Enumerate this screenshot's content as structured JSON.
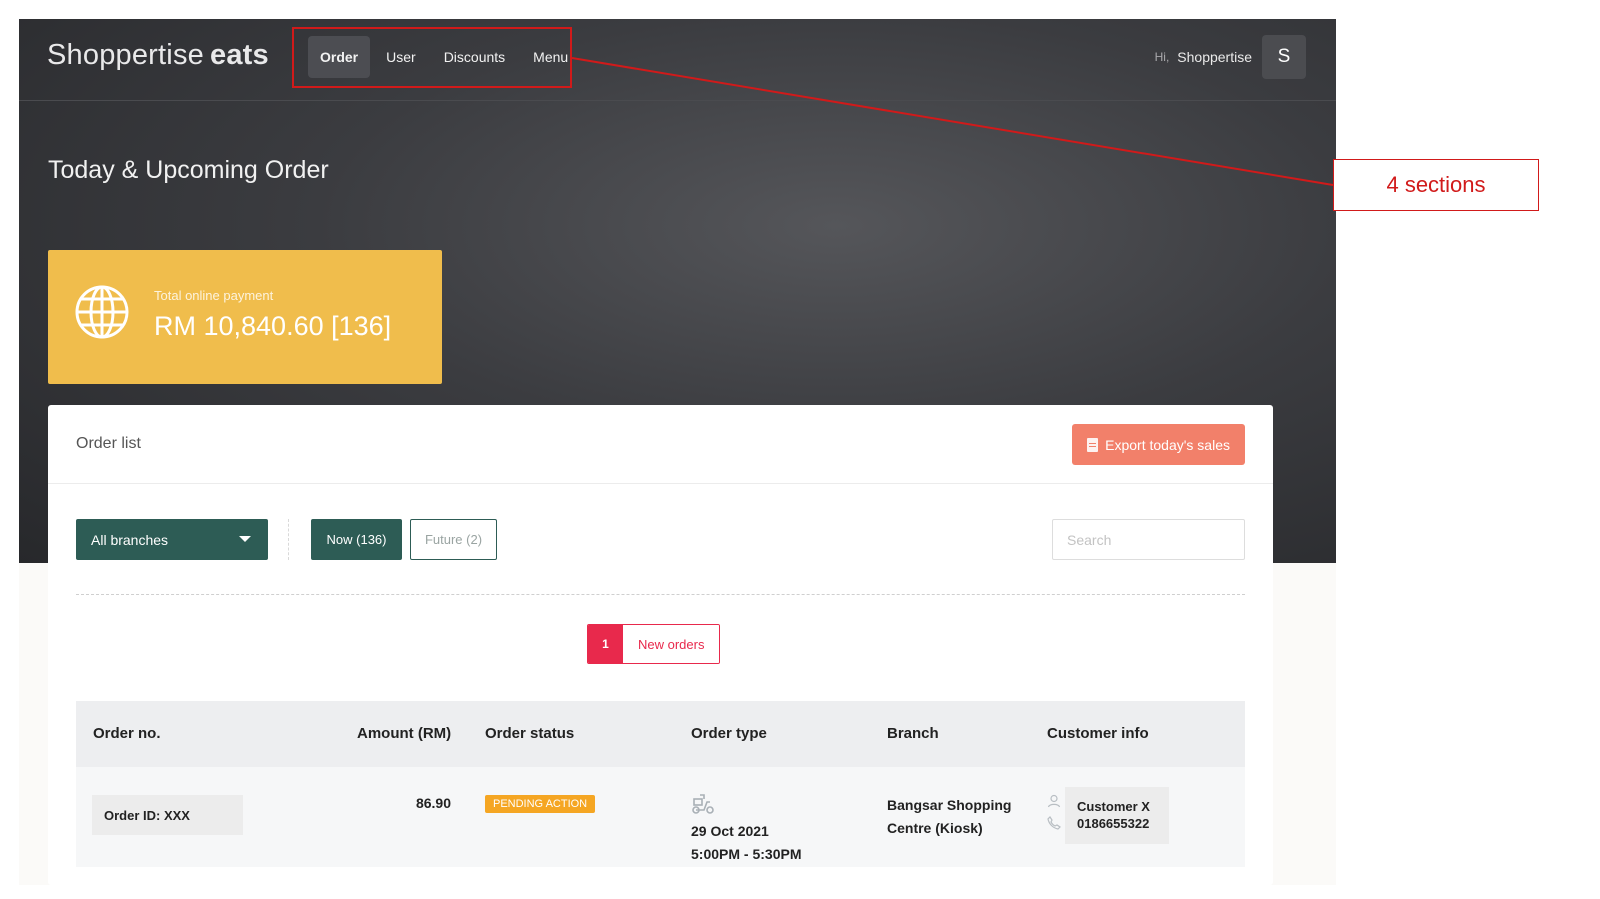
{
  "app": {
    "logo_light": "Shoppertise",
    "logo_bold": "eats"
  },
  "nav": {
    "items": [
      {
        "label": "Order",
        "active": true
      },
      {
        "label": "User",
        "active": false
      },
      {
        "label": "Discounts",
        "active": false
      },
      {
        "label": "Menu",
        "active": false
      }
    ]
  },
  "user": {
    "greeting": "Hi,",
    "name": "Shoppertise",
    "avatar_letter": "S"
  },
  "page": {
    "title": "Today & Upcoming Order"
  },
  "payment_card": {
    "label": "Total online payment",
    "value": "RM 10,840.60 [136]",
    "color": "#f0bd4c",
    "icon": "globe-icon"
  },
  "order_list": {
    "title": "Order list",
    "export_label": "Export today's sales",
    "export_icon": "document-icon",
    "branch_select": "All branches",
    "tab_now": "Now (136)",
    "tab_future": "Future (2)",
    "search_placeholder": "Search",
    "new_orders_count": "1",
    "new_orders_label": "New orders",
    "columns": [
      "Order no.",
      "Amount (RM)",
      "Order status",
      "Order type",
      "Branch",
      "Customer info"
    ],
    "rows": [
      {
        "order_id": "Order ID: XXX",
        "amount": "86.90",
        "status": "PENDING ACTION",
        "type_icon": "delivery-scooter-icon",
        "date": "29 Oct 2021",
        "time": "5:00PM - 5:30PM",
        "branch": "Bangsar Shopping Centre (Kiosk)",
        "customer_name": "Customer X",
        "customer_phone": "0186655322"
      }
    ]
  },
  "annotation": {
    "text": "4 sections",
    "color": "#d11a1a"
  },
  "colors": {
    "primary": "#2d5c55",
    "export": "#f2806a",
    "alert": "#e8294c",
    "status_pending": "#f5a623"
  }
}
